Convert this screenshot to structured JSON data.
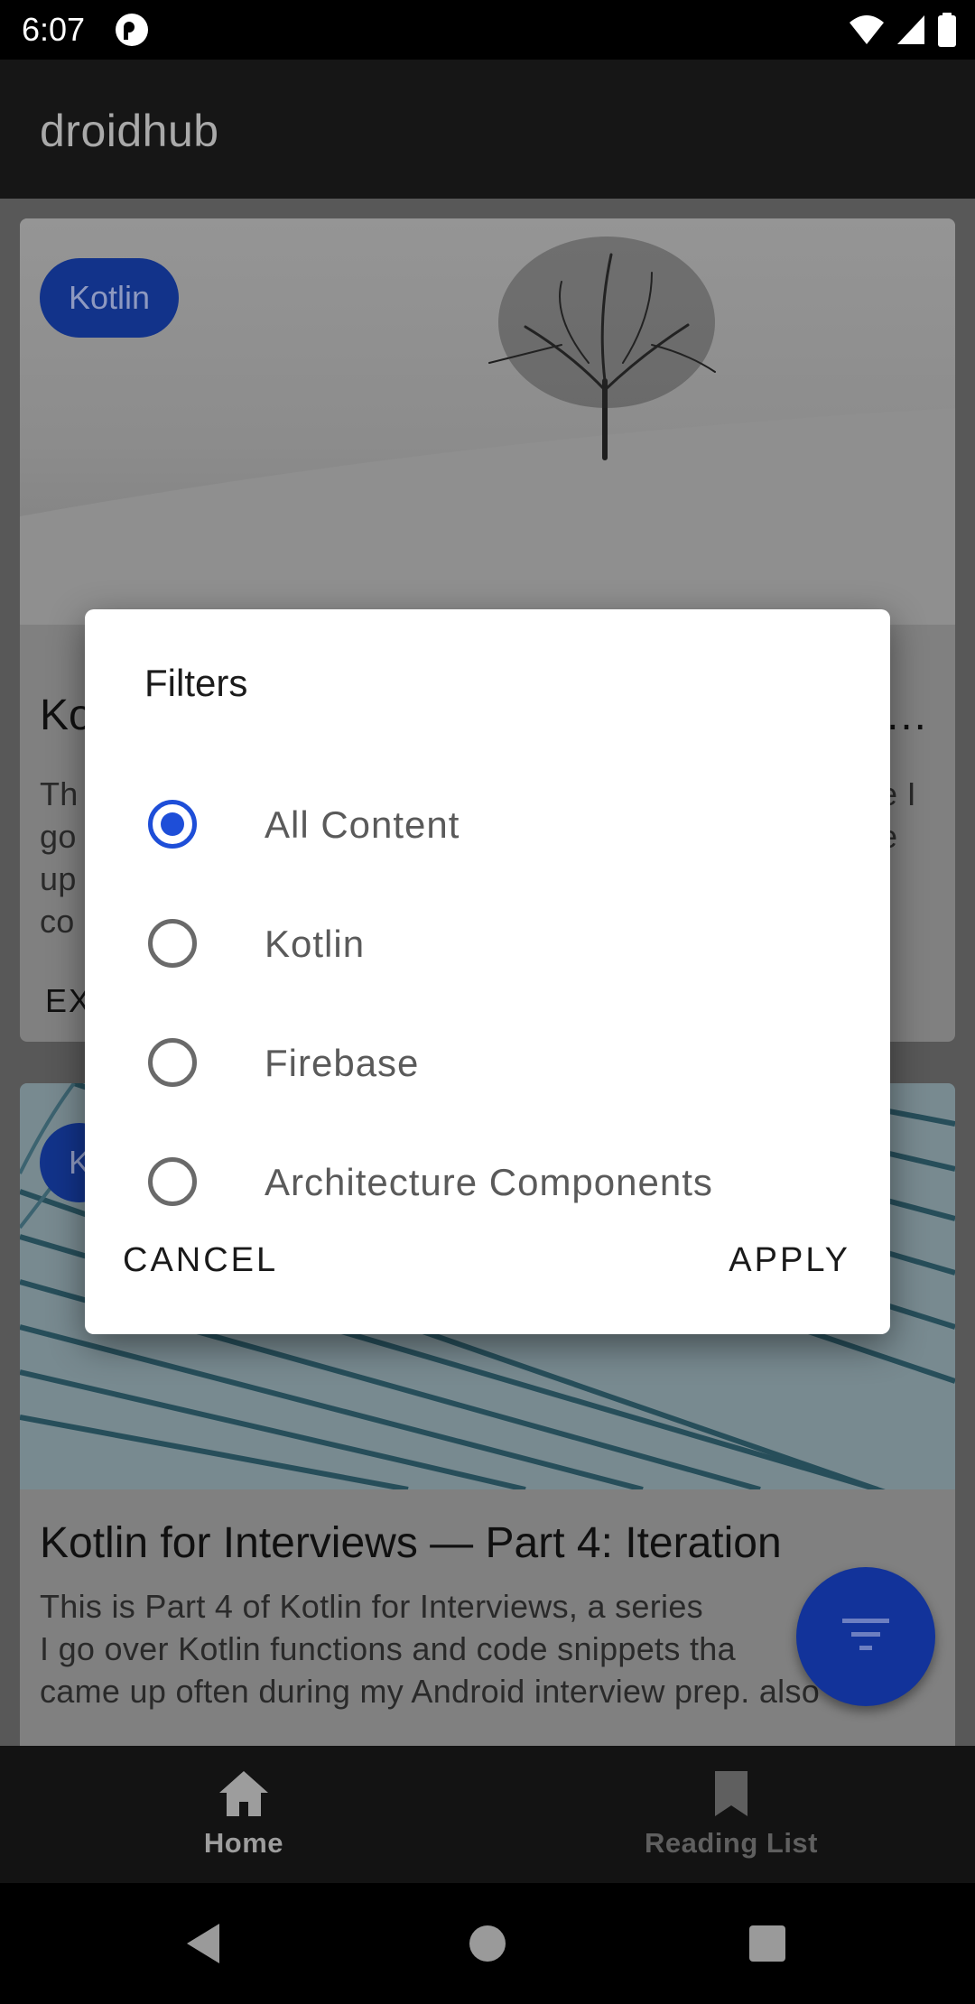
{
  "status_bar": {
    "time": "6:07"
  },
  "app_bar": {
    "title": "droidhub"
  },
  "feed": {
    "cards": [
      {
        "chip": "Kotlin",
        "title": "Ko",
        "title_tail": "…",
        "text_left": [
          "Th",
          "go",
          "up",
          "co"
        ],
        "text_right": [
          "e I",
          "e"
        ],
        "action": "EX"
      },
      {
        "chip": "K",
        "title": "Kotlin for Interviews — Part 4: Iteration",
        "text_lines": [
          "This is Part 4 of Kotlin for Interviews, a series",
          "I go over Kotlin functions and code snippets tha",
          "came up often during my Android interview prep. also"
        ]
      }
    ]
  },
  "bottom_nav": {
    "items": [
      {
        "label": "Home",
        "icon": "home-icon",
        "active": true
      },
      {
        "label": "Reading List",
        "icon": "bookmark-icon",
        "active": false
      }
    ]
  },
  "dialog": {
    "title": "Filters",
    "options": [
      {
        "label": "All Content",
        "selected": true
      },
      {
        "label": "Kotlin",
        "selected": false
      },
      {
        "label": "Firebase",
        "selected": false
      },
      {
        "label": "Architecture Components",
        "selected": false
      }
    ],
    "cancel_label": "CANCEL",
    "apply_label": "APPLY"
  },
  "colors": {
    "accent": "#1e4ed8",
    "fab": "#12339a",
    "dialog_bg": "#ffffff"
  }
}
